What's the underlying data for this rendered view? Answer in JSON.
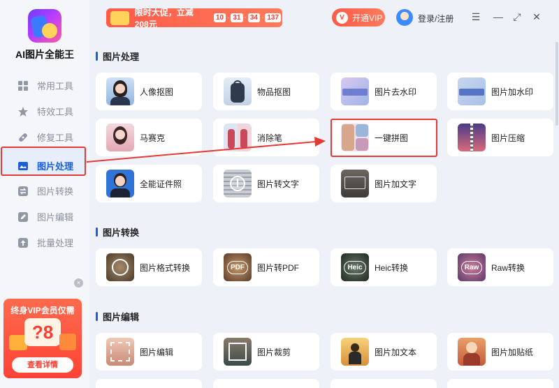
{
  "app": {
    "name": "AI图片全能王"
  },
  "sidebar": {
    "items": [
      {
        "label": "常用工具",
        "icon": "grid-icon"
      },
      {
        "label": "特效工具",
        "icon": "star-icon"
      },
      {
        "label": "修复工具",
        "icon": "bandage-icon"
      },
      {
        "label": "图片处理",
        "icon": "image-icon",
        "active": true
      },
      {
        "label": "图片转换",
        "icon": "swap-icon"
      },
      {
        "label": "图片编辑",
        "icon": "edit-icon"
      },
      {
        "label": "批量处理",
        "icon": "upload-icon"
      }
    ]
  },
  "ad": {
    "title": "终身VIP会员仅需",
    "price": "?8",
    "button": "查看详情",
    "close": "×"
  },
  "topbar": {
    "promo_text": "限时大促，立减208元",
    "countdown": [
      "10",
      "31",
      "34",
      "137"
    ],
    "vip_label": "开通VIP",
    "vip_icon": "V",
    "login_label": "登录/注册",
    "menu_icon": "☰",
    "minimize_icon": "—",
    "maximize_icon": "⤢",
    "close_icon": "✕"
  },
  "sections": [
    {
      "title": "图片处理",
      "tools": [
        {
          "label": "人像抠图",
          "icon": "portrait-cutout-icon"
        },
        {
          "label": "物品抠图",
          "icon": "object-cutout-icon"
        },
        {
          "label": "图片去水印",
          "icon": "remove-watermark-icon"
        },
        {
          "label": "图片加水印",
          "icon": "add-watermark-icon"
        },
        {
          "label": "马赛克",
          "icon": "mosaic-icon"
        },
        {
          "label": "消除笔",
          "icon": "eraser-pen-icon"
        },
        {
          "label": "一键拼图",
          "icon": "collage-icon"
        },
        {
          "label": "图片压缩",
          "icon": "compress-icon"
        },
        {
          "label": "全能证件照",
          "icon": "id-photo-icon"
        },
        {
          "label": "图片转文字",
          "icon": "image-to-text-icon"
        },
        {
          "label": "图片加文字",
          "icon": "add-text-icon"
        }
      ]
    },
    {
      "title": "图片转换",
      "tools": [
        {
          "label": "图片格式转换",
          "icon": "format-convert-icon"
        },
        {
          "label": "图片转PDF",
          "icon": "pdf-icon",
          "badge": "PDF"
        },
        {
          "label": "Heic转换",
          "icon": "heic-icon",
          "badge": "Heic"
        },
        {
          "label": "Raw转换",
          "icon": "raw-icon",
          "badge": "Raw"
        }
      ]
    },
    {
      "title": "图片编辑",
      "tools": [
        {
          "label": "图片编辑",
          "icon": "image-edit-icon"
        },
        {
          "label": "图片裁剪",
          "icon": "crop-icon"
        },
        {
          "label": "图片加文本",
          "icon": "add-caption-icon"
        },
        {
          "label": "图片加贴纸",
          "icon": "sticker-icon"
        }
      ]
    }
  ],
  "colors": {
    "accent": "#1a5fd8",
    "promo": "#ff5a4a",
    "highlight": "#e53935"
  }
}
